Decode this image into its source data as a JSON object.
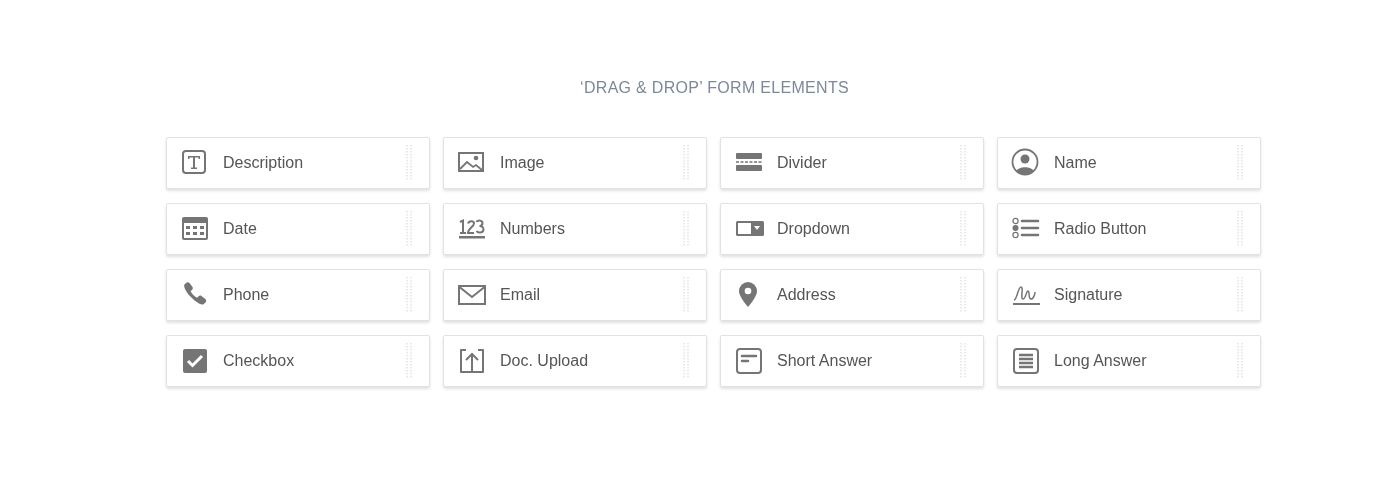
{
  "title": "‘DRAG & DROP’ FORM ELEMENTS",
  "elements": [
    {
      "kind": "description",
      "label": "Description"
    },
    {
      "kind": "image",
      "label": "Image"
    },
    {
      "kind": "divider",
      "label": "Divider"
    },
    {
      "kind": "name",
      "label": "Name"
    },
    {
      "kind": "date",
      "label": "Date"
    },
    {
      "kind": "numbers",
      "label": "Numbers"
    },
    {
      "kind": "dropdown",
      "label": "Dropdown"
    },
    {
      "kind": "radio",
      "label": "Radio Button"
    },
    {
      "kind": "phone",
      "label": "Phone"
    },
    {
      "kind": "email",
      "label": "Email"
    },
    {
      "kind": "address",
      "label": "Address"
    },
    {
      "kind": "signature",
      "label": "Signature"
    },
    {
      "kind": "checkbox",
      "label": "Checkbox"
    },
    {
      "kind": "upload",
      "label": "Doc. Upload"
    },
    {
      "kind": "short",
      "label": "Short Answer"
    },
    {
      "kind": "long",
      "label": "Long Answer"
    }
  ]
}
